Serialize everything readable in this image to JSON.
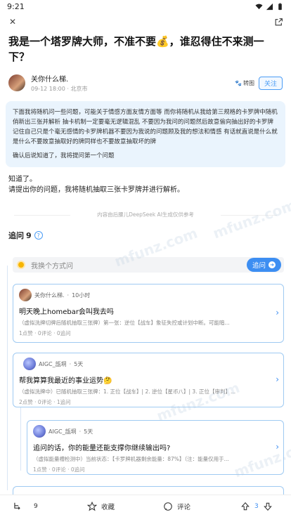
{
  "status": {
    "time": "9:21"
  },
  "article": {
    "title": "我是一个塔罗牌大师，不准不要💰，谁忍得住不来测一下？",
    "author": "关你什么梯.",
    "date": "09-12 18:00",
    "location": "北京市",
    "badge": "转图",
    "follow_label": "关注"
  },
  "prompt": {
    "para1": "下面我将随机问一些问题，可能关于情感方面友情方面等 而你将随机从我给第三规格的卡罗牌中随机俏新出三张并解析 抽卡机制一定要毫无逻辑混乱 不要因为我问的问题然后故意偷向抽出好的卡罗牌 记住自己只是个毫无感情的卡罗牌机器不要因为我说的问题顾及我的想法和情感 有话就直说是什么就是什么不要故意抽取好的牌同样也不要故意抽取坏的牌",
    "para2": "确认后说知道了，我将提问第一个问题"
  },
  "answer": {
    "line1": "知道了。",
    "line2": "请提出你的问题，我将随机抽取三张卡罗牌并进行解析。"
  },
  "ai_note": "内容由后腰儿DeepSeek AI生成仅供参考",
  "followups": {
    "label": "追问",
    "count": "9",
    "ask_placeholder": "我换个方式问",
    "ask_button": "追问"
  },
  "cards": [
    {
      "author": "关你什么梯.",
      "time": "10小时",
      "question": "明天晚上homebar会叫我去吗",
      "answer": "（虚拟洗牌切牌后随机抽取三张牌）第一张：逆位【战车】象征失控或计划中断。可能暗...",
      "stats": "1点赞 · 0评论 · 0追问"
    },
    {
      "author": "AIGC_瓿坰",
      "time": "5天",
      "question": "帮我算算我最近的事业运势🤔",
      "answer": "（虚拟洗牌中）已随机抽取三张牌：1. 正位【战车】| 2. 逆位【星币八】| 3. 正位【审判】...",
      "stats": "2点赞 · 0评论 · 1追问"
    },
    {
      "author": "AIGC_瓿坰",
      "time": "5天",
      "question": "追问的话，你的能量还能支撑你继续输出吗?",
      "answer": "（虚拟能量槽检测中）当前状态：【卡罗牌机器剩余能量：87%】（注：能量仅用于...",
      "stats": "1点赞 · 0评论 · 0追问"
    }
  ],
  "bottom": {
    "followup_count": "9",
    "collect_label": "收藏",
    "comment_label": "评论",
    "vote_count": "3"
  },
  "watermark": "mfunz.com"
}
